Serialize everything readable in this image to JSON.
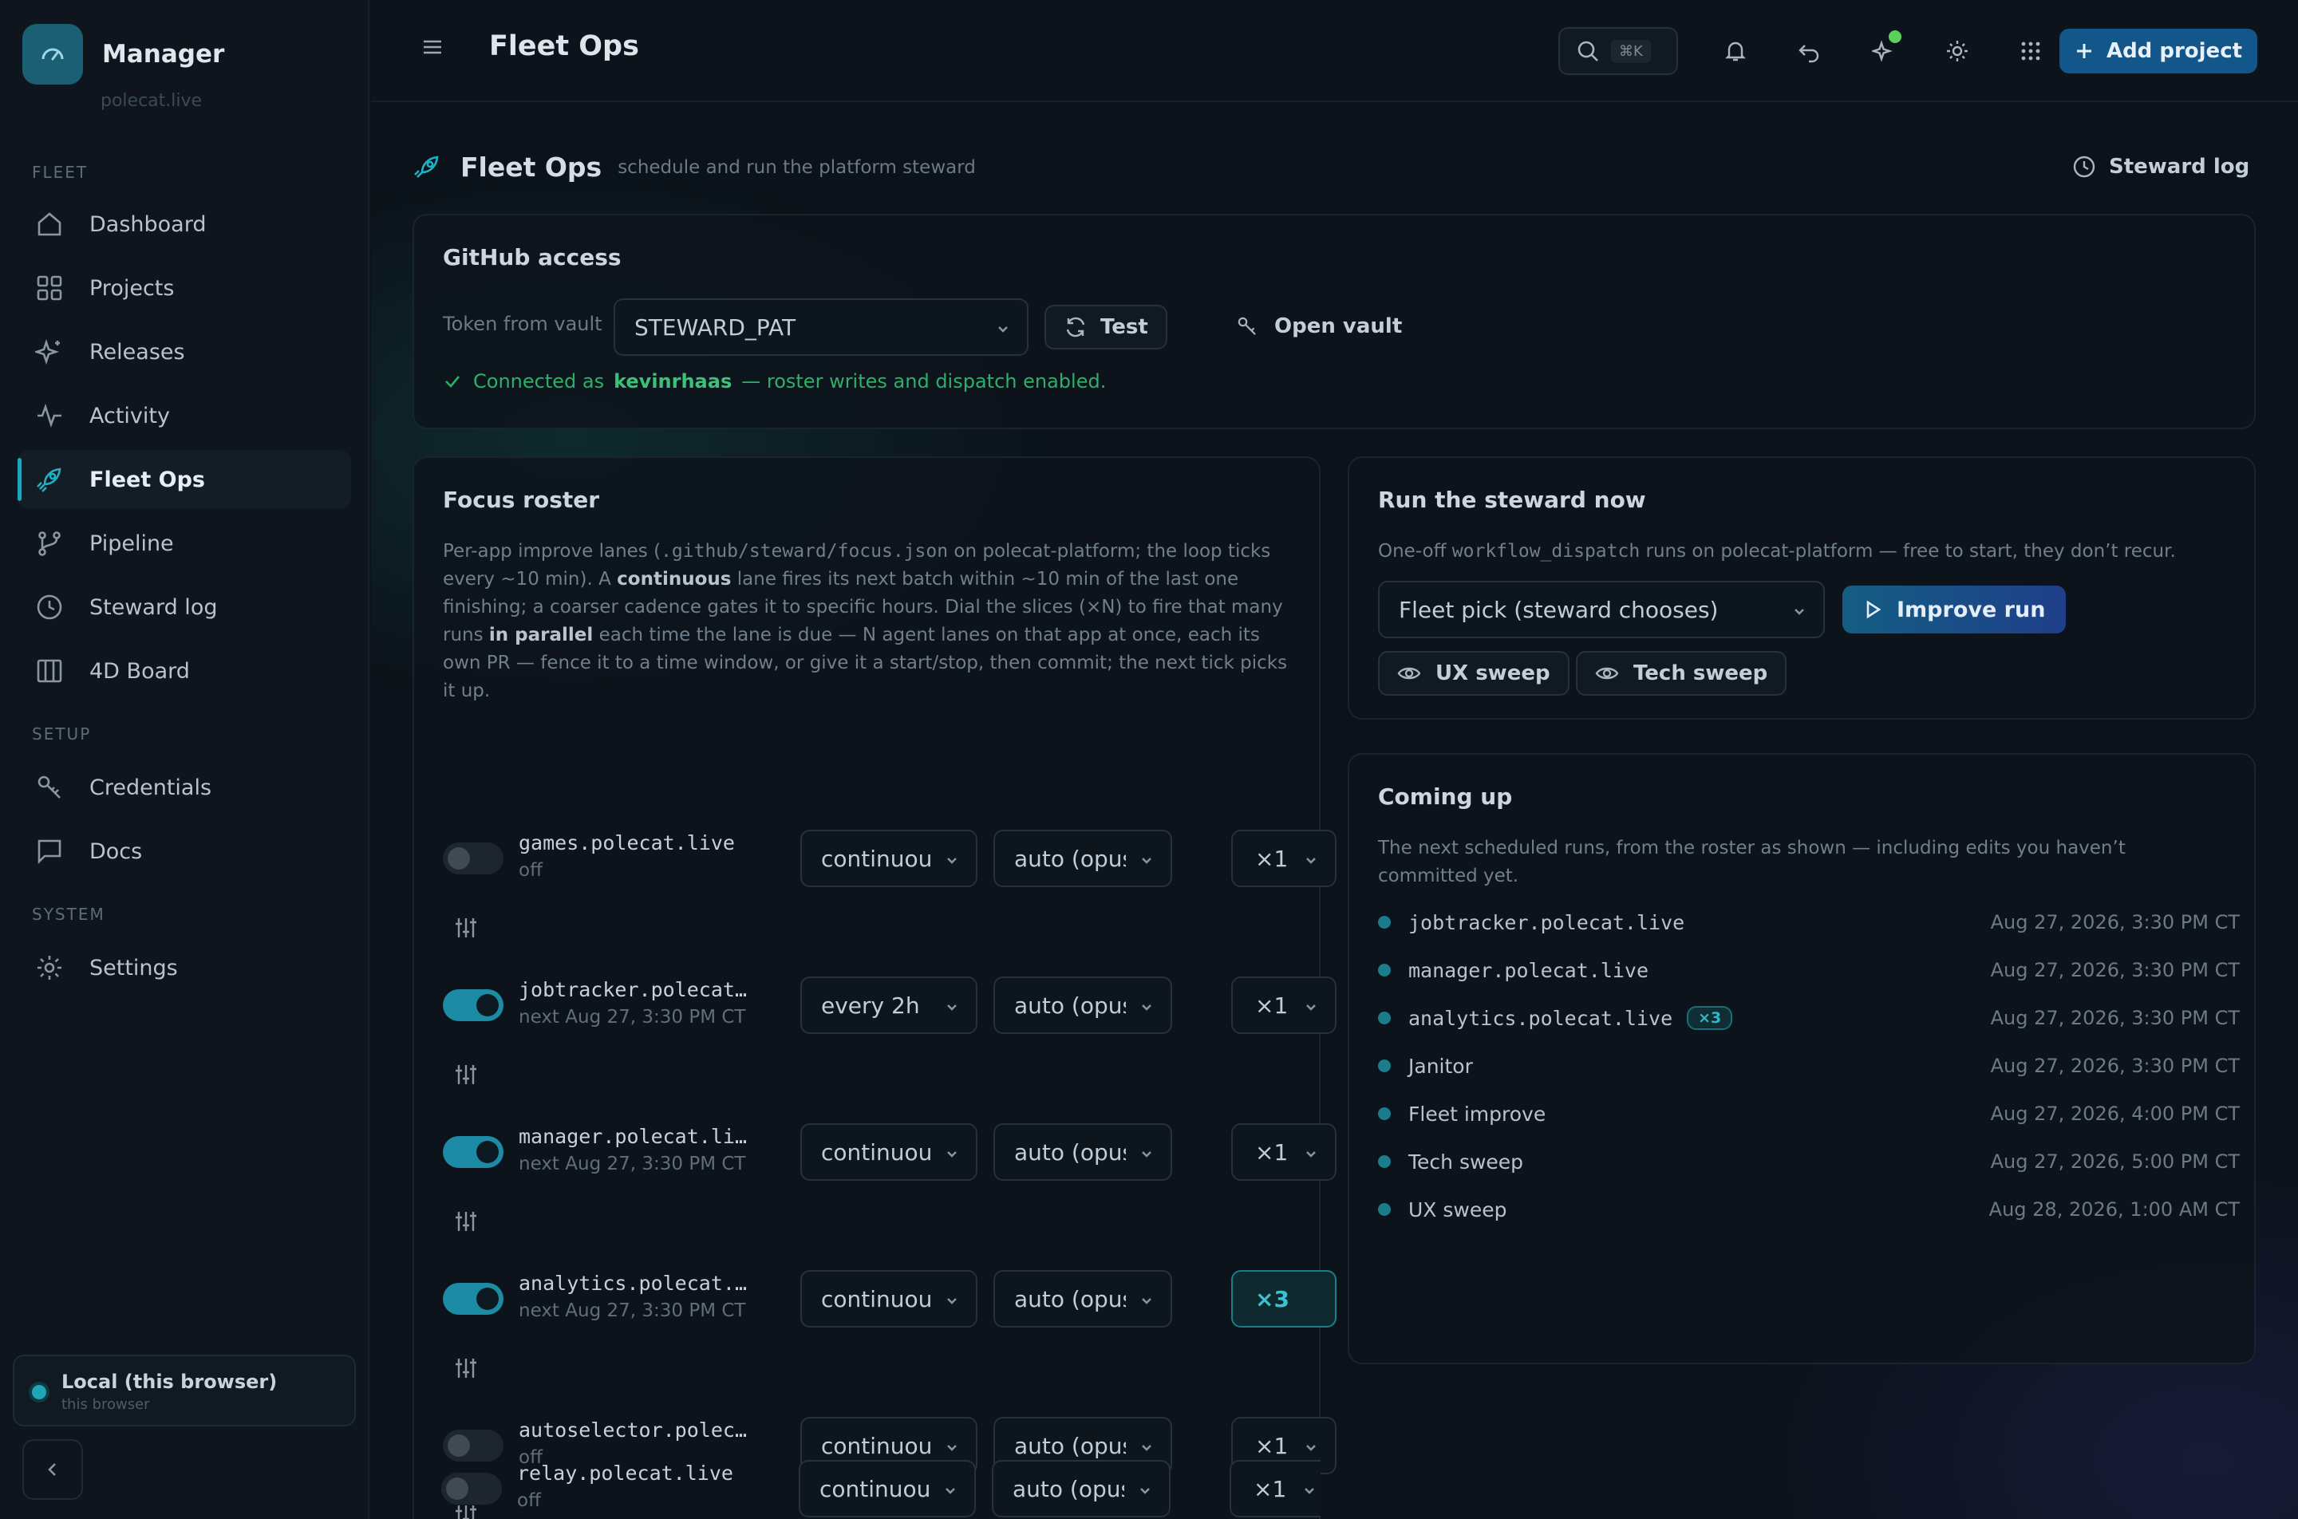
{
  "app": {
    "name": "Manager",
    "subtitle": "polecat.live"
  },
  "sidebar": {
    "sections": {
      "fleet": "FLEET",
      "setup": "SETUP",
      "system": "SYSTEM"
    },
    "items": [
      {
        "label": "Dashboard",
        "icon": "home-icon"
      },
      {
        "label": "Projects",
        "icon": "grid-icon"
      },
      {
        "label": "Releases",
        "icon": "sparkle-icon"
      },
      {
        "label": "Activity",
        "icon": "pulse-icon"
      },
      {
        "label": "Fleet Ops",
        "icon": "rocket-icon",
        "active": true
      },
      {
        "label": "Pipeline",
        "icon": "branch-icon"
      },
      {
        "label": "Steward log",
        "icon": "clock-icon"
      },
      {
        "label": "4D Board",
        "icon": "columns-icon"
      },
      {
        "label": "Credentials",
        "icon": "key-icon"
      },
      {
        "label": "Docs",
        "icon": "doc-icon"
      },
      {
        "label": "Settings",
        "icon": "gear-icon"
      }
    ],
    "local": {
      "title": "Local (this browser)",
      "subtitle": "this browser"
    }
  },
  "topbar": {
    "title": "Fleet Ops",
    "search_shortcut": "⌘K",
    "add_project": "Add project"
  },
  "page": {
    "title": "Fleet Ops",
    "subtitle": "schedule and run the platform steward",
    "steward_log": "Steward log"
  },
  "github": {
    "title": "GitHub access",
    "token_label": "Token from vault",
    "token_value": "STEWARD_PAT",
    "test_label": "Test",
    "open_vault_label": "Open vault",
    "status_prefix": "Connected as",
    "status_user": "kevinrhaas",
    "status_suffix": "— roster writes and dispatch enabled."
  },
  "roster": {
    "title": "Focus roster",
    "desc": {
      "p1": "Per-app improve lanes (",
      "code": ".github/steward/focus.json",
      "p2": " on polecat-platform; the loop ticks every ~10 min). A ",
      "b1": "continuous",
      "p3": " lane fires its next batch within ~10 min of the last one finishing; a coarser cadence gates it to specific hours. Dial the slices (×N) to fire that many runs ",
      "b2": "in parallel",
      "p4": " each time the lane is due — N agent lanes on that app at once, each its own PR — fence it to a time window, or give it a start/stop, then commit; the next tick picks it up."
    },
    "lanes": [
      {
        "name": "games.polecat.live",
        "status": "off",
        "on": false,
        "cadence": "continuous",
        "model": "auto (opus)",
        "mult": "×1"
      },
      {
        "name": "jobtracker.polecat.live",
        "status": "next Aug 27, 3:30 PM CT",
        "on": true,
        "cadence": "every 2h",
        "model": "auto (opus)",
        "mult": "×1"
      },
      {
        "name": "manager.polecat.live",
        "status": "next Aug 27, 3:30 PM CT",
        "on": true,
        "cadence": "continuous",
        "model": "auto (opus)",
        "mult": "×1"
      },
      {
        "name": "analytics.polecat.live",
        "status": "next Aug 27, 3:30 PM CT",
        "on": true,
        "cadence": "continuous",
        "model": "auto (opus)",
        "mult": "×3",
        "highlight": true
      },
      {
        "name": "autoselector.polecat.live",
        "status": "off",
        "on": false,
        "cadence": "continuous",
        "model": "auto (opus)",
        "mult": "×1"
      },
      {
        "name": "relay.polecat.live",
        "status": "off",
        "on": false,
        "cadence": "continuous",
        "model": "auto (opus)",
        "mult": "×1"
      }
    ]
  },
  "run_now": {
    "title": "Run the steward now",
    "desc_p1": "One-off ",
    "desc_code": "workflow_dispatch",
    "desc_p2": " runs on polecat-platform — free to start, they don’t recur.",
    "pick": "Fleet pick (steward chooses)",
    "improve": "Improve run",
    "ux": "UX sweep",
    "tech": "Tech sweep"
  },
  "coming_up": {
    "title": "Coming up",
    "desc": "The next scheduled runs, from the roster as shown — including edits you haven’t committed yet.",
    "rows": [
      {
        "name": "jobtracker.polecat.live",
        "mono": true,
        "when": "Aug 27, 2026, 3:30 PM CT"
      },
      {
        "name": "manager.polecat.live",
        "mono": true,
        "when": "Aug 27, 2026, 3:30 PM CT"
      },
      {
        "name": "analytics.polecat.live",
        "mono": true,
        "badge": "×3",
        "when": "Aug 27, 2026, 3:30 PM CT"
      },
      {
        "name": "Janitor",
        "mono": false,
        "when": "Aug 27, 2026, 3:30 PM CT"
      },
      {
        "name": "Fleet improve",
        "mono": false,
        "when": "Aug 27, 2026, 4:00 PM CT"
      },
      {
        "name": "Tech sweep",
        "mono": false,
        "when": "Aug 27, 2026, 5:00 PM CT"
      },
      {
        "name": "UX sweep",
        "mono": false,
        "when": "Aug 28, 2026, 1:00 AM CT"
      }
    ]
  },
  "colors": {
    "accent": "#1fa4b8",
    "primary": "#13568a",
    "success": "#2fae6a"
  }
}
